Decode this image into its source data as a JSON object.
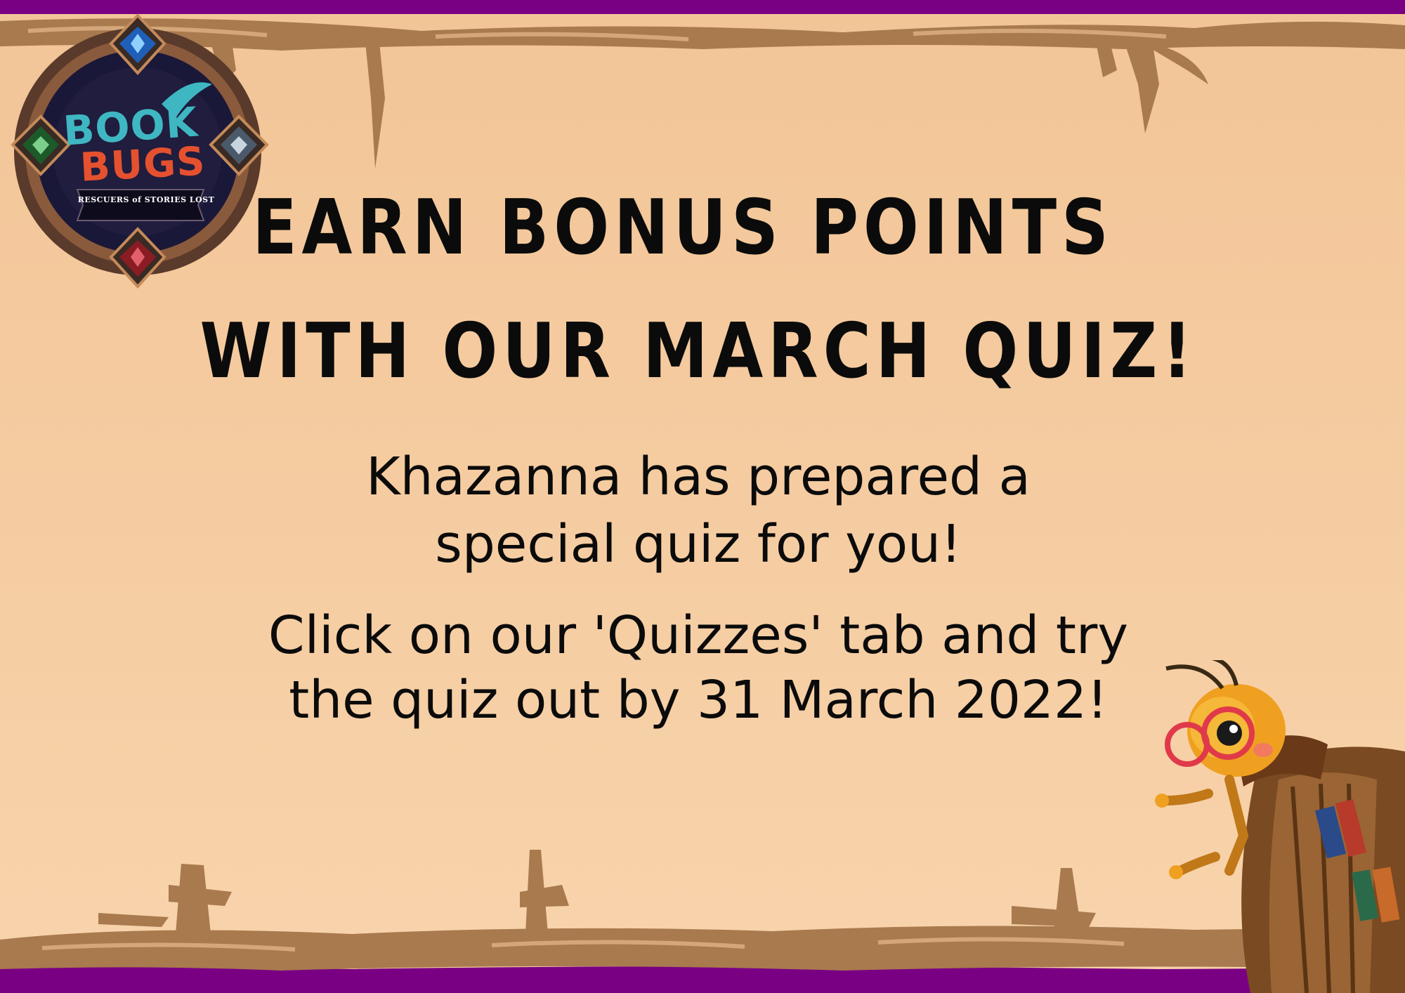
{
  "colors": {
    "border": "#7a0083",
    "parchment": "#f4c99c",
    "wood": "#a87a4e",
    "text": "#0b0b0b",
    "logo_book": "#3fb7c2",
    "logo_bugs": "#e5512f"
  },
  "logo": {
    "line1": "BOOK",
    "line2": "BUGS",
    "tagline": "RESCUERS of STORIES LOST"
  },
  "headline": {
    "line1": "EARN BONUS POINTS",
    "line2": "WITH OUR MARCH QUIZ!"
  },
  "body": {
    "paragraph1_line1": "Khazanna has prepared a",
    "paragraph1_line2": "special quiz for you!",
    "paragraph2_line1": "Click on our 'Quizzes' tab and try",
    "paragraph2_line2": "the quiz out by 31 March 2022!"
  },
  "icons": {
    "logo": "book-bugs-emblem",
    "mascot": "bookworm-bug-mascot"
  }
}
